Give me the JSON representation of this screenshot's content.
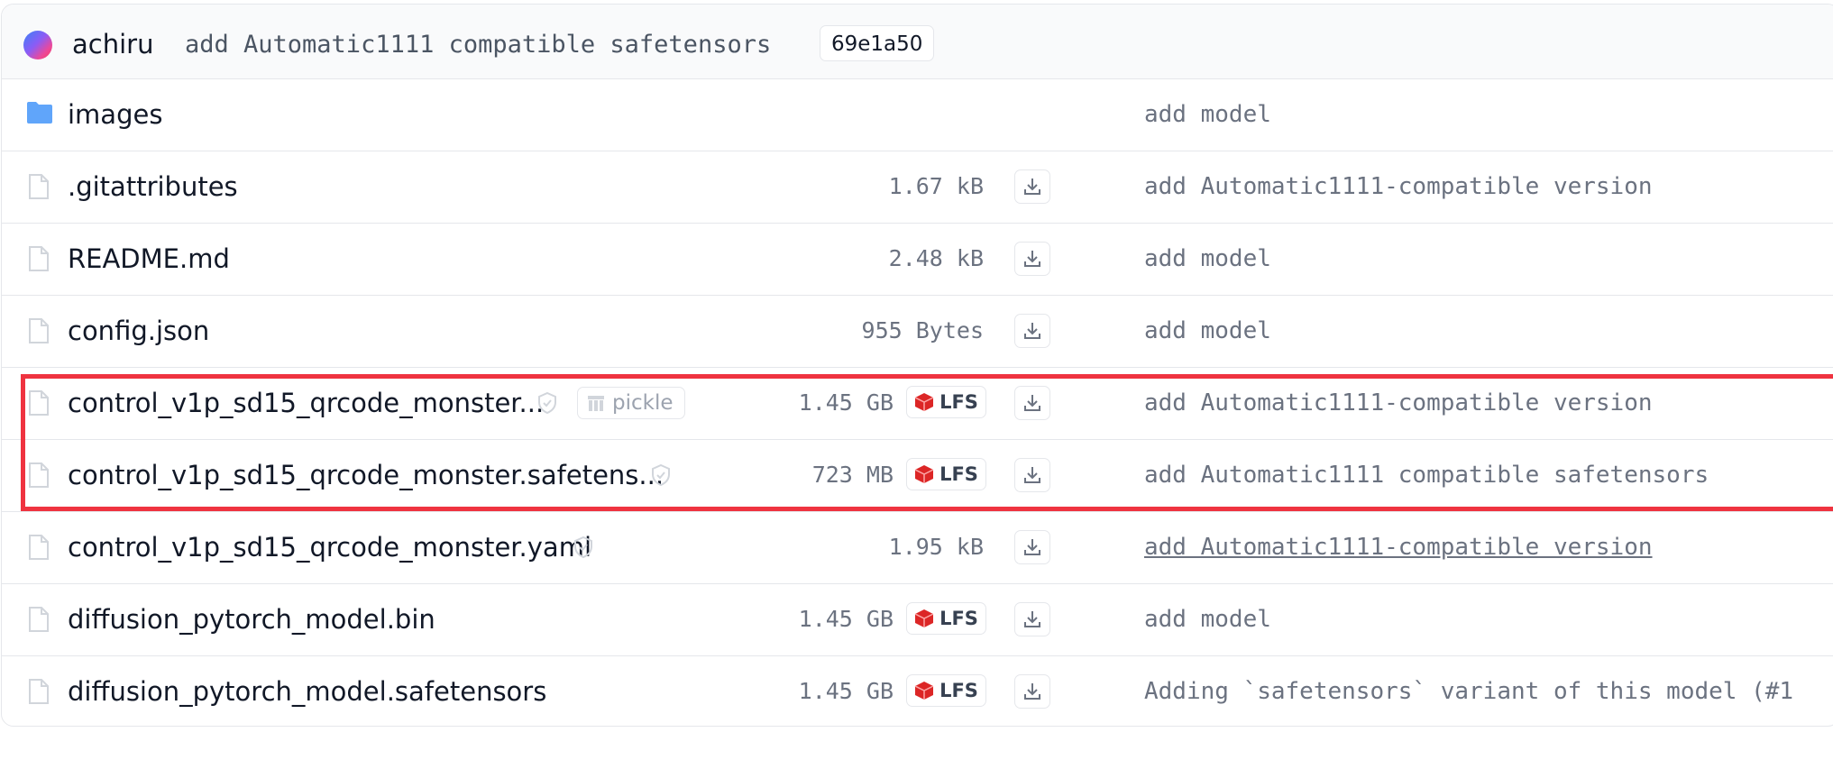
{
  "header": {
    "author": "achiru",
    "commit_message": "add Automatic1111 compatible safetensors",
    "commit_hash": "69e1a50"
  },
  "files": [
    {
      "name": "images",
      "type": "folder",
      "size": "",
      "lfs": false,
      "commit": "add model"
    },
    {
      "name": ".gitattributes",
      "type": "file",
      "size": "1.67 kB",
      "lfs": false,
      "commit": "add Automatic1111-compatible version"
    },
    {
      "name": "README.md",
      "type": "file",
      "size": "2.48 kB",
      "lfs": false,
      "commit": "add model"
    },
    {
      "name": "config.json",
      "type": "file",
      "size": "955 Bytes",
      "lfs": false,
      "commit": "add model"
    },
    {
      "name": "control_v1p_sd15_qrcode_monster...",
      "type": "file",
      "size": "1.45 GB",
      "lfs": true,
      "pickle": "pickle",
      "commit": "add Automatic1111-compatible version"
    },
    {
      "name": "control_v1p_sd15_qrcode_monster.safetens...",
      "type": "file",
      "size": "723 MB",
      "lfs": true,
      "commit": "add Automatic1111 compatible safetensors"
    },
    {
      "name": "control_v1p_sd15_qrcode_monster.yaml",
      "type": "file",
      "size": "1.95 kB",
      "lfs": false,
      "commit": "add Automatic1111-compatible version"
    },
    {
      "name": "diffusion_pytorch_model.bin",
      "type": "file",
      "size": "1.45 GB",
      "lfs": true,
      "commit": "add model"
    },
    {
      "name": "diffusion_pytorch_model.safetensors",
      "type": "file",
      "size": "1.45 GB",
      "lfs": true,
      "commit": "Adding `safetensors` variant of this model (#1"
    }
  ],
  "lfs_label": "LFS",
  "colors": {
    "highlight": "#ef3340",
    "folder": "#60a5fa",
    "lfs_icon": "#dc2626"
  }
}
